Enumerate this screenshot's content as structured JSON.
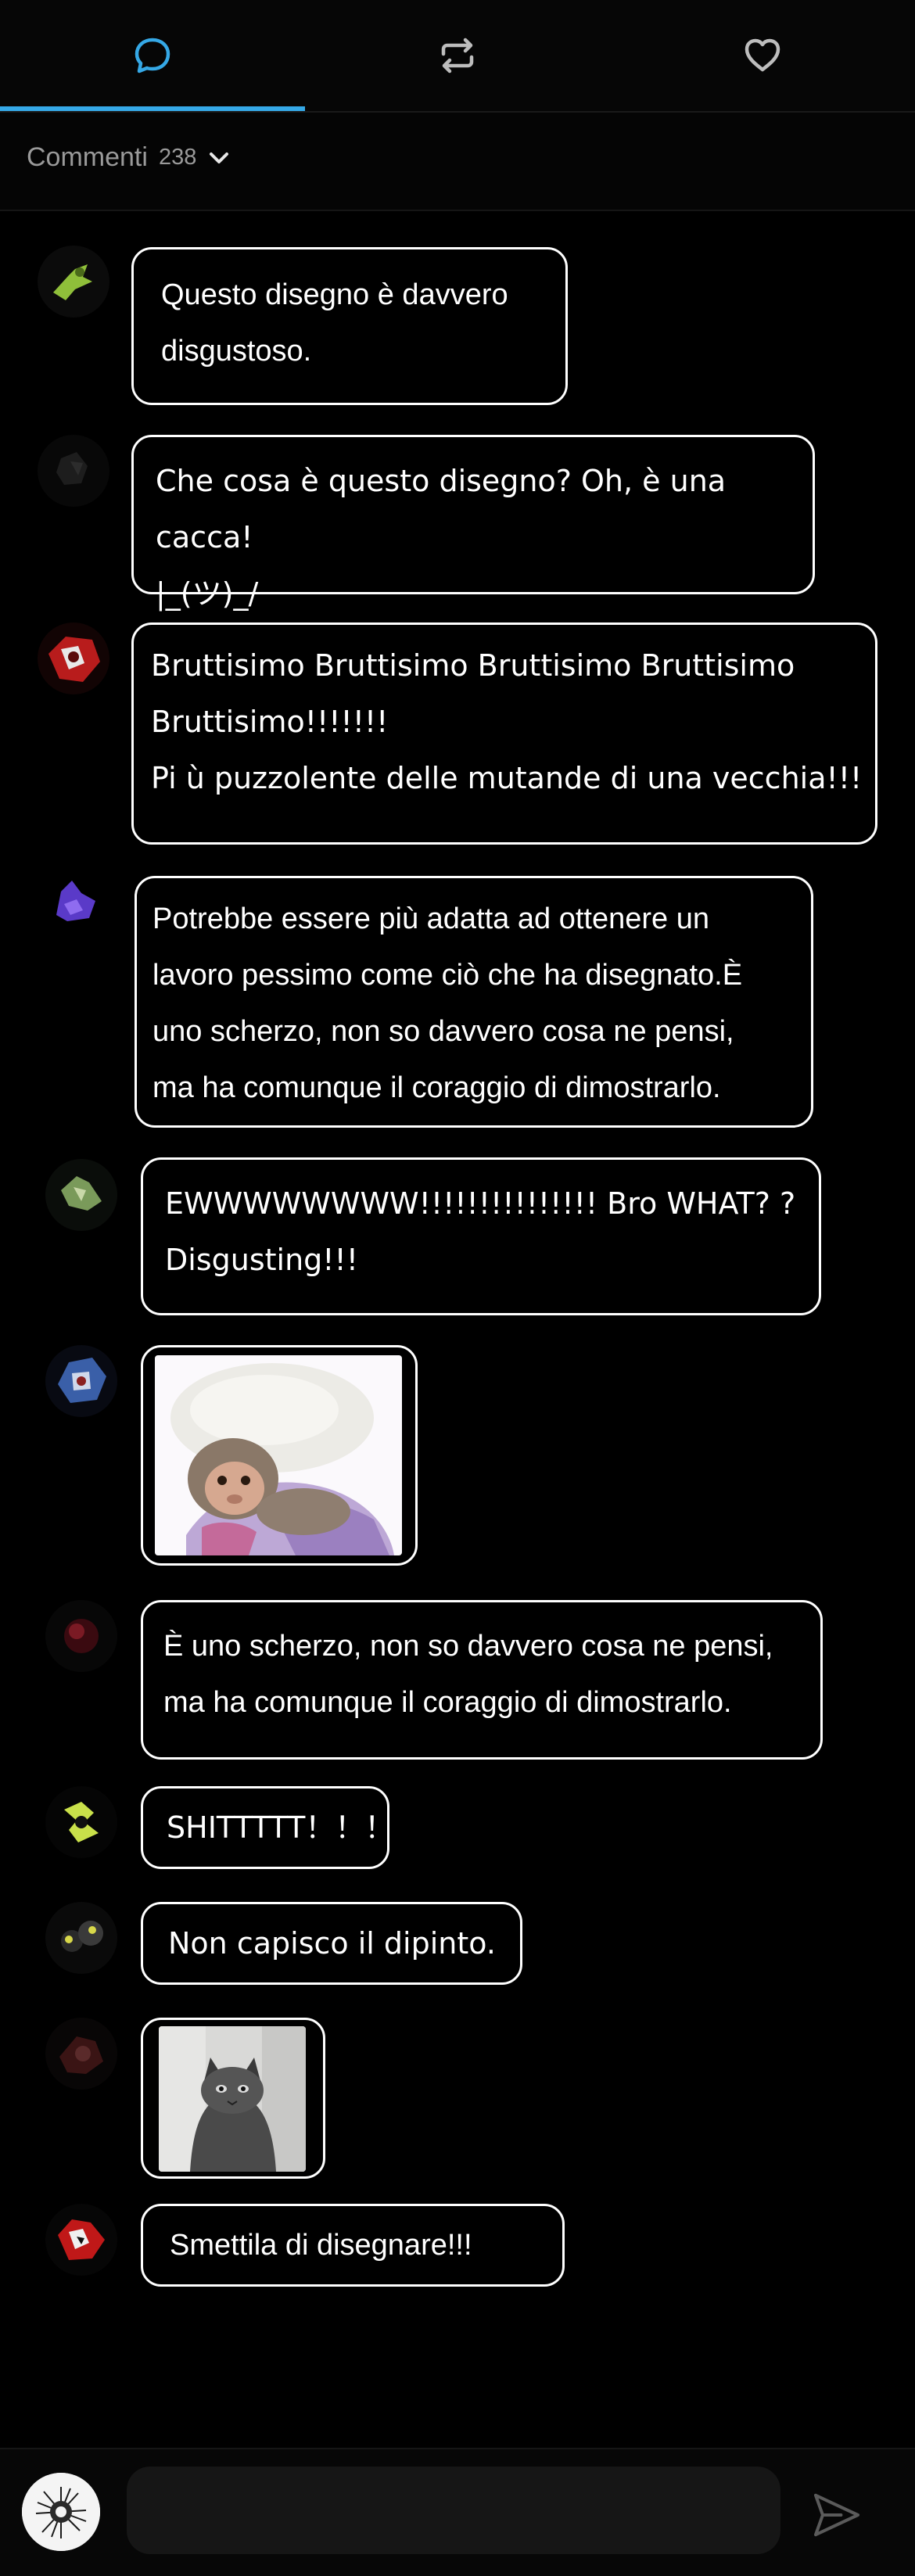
{
  "colors": {
    "background": "#000000",
    "accent": "#35a8e6",
    "muted_text": "#9a9a9a",
    "bubble_border": "#ffffff",
    "input_background": "#161616"
  },
  "tabs": [
    {
      "name": "comments",
      "icon": "comment-bubble-icon",
      "active": true
    },
    {
      "name": "reposts",
      "icon": "repost-icon",
      "active": false
    },
    {
      "name": "likes",
      "icon": "heart-icon",
      "active": false
    }
  ],
  "comments_header": {
    "label": "Commenti",
    "count": "238",
    "icon": "chevron-down-icon"
  },
  "comments": [
    {
      "type": "text",
      "text": "Questo disegno è davvero\ndisgustoso."
    },
    {
      "type": "text",
      "text": "Che cosa  è  questo disegno? Oh,  è  una cacca!\n|_(ツ)_/"
    },
    {
      "type": "text",
      "text": "Bruttisimo Bruttisimo Bruttisimo Bruttisimo\nBruttisimo!!!!!!!\nPi ù  puzzolente delle mutande di una vecchia!!!"
    },
    {
      "type": "text",
      "text": "Potrebbe essere più adatta ad ottenere un\nlavoro pessimo come ciò che ha disegnato.È\nuno scherzo, non so davvero cosa ne pensi,\nma ha comunque il coraggio di dimostrarlo."
    },
    {
      "type": "text",
      "text": "EWWWWWWWW!!!!!!!!!!!!!!!    Bro WHAT?  ?\nDisgusting!!!"
    },
    {
      "type": "image",
      "image": "baby-monkey-photo"
    },
    {
      "type": "text",
      "text": "È uno scherzo, non so davvero cosa ne pensi,\nma ha comunque il coraggio di dimostrarlo."
    },
    {
      "type": "text",
      "text": "SHITTTTT！！！"
    },
    {
      "type": "text",
      "text": "Non capisco il dipinto."
    },
    {
      "type": "image",
      "image": "wet-cat-photo"
    },
    {
      "type": "text",
      "text": "Smettila di disegnare!!!"
    }
  ],
  "input": {
    "placeholder": "",
    "send_icon": "send-icon",
    "avatar_icon": "user-avatar"
  }
}
